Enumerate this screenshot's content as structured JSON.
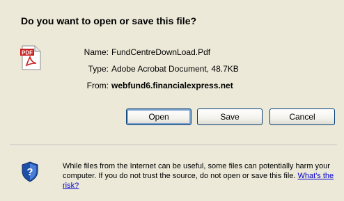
{
  "dialog": {
    "title": "Do you want to open or save this file?"
  },
  "file": {
    "icon": "pdf-file-icon",
    "name_label": "Name:",
    "name_value": "FundCentreDownLoad.Pdf",
    "type_label": "Type:",
    "type_value": "Adobe Acrobat Document, 48.7KB",
    "from_label": "From:",
    "from_value": "webfund6.financialexpress.net"
  },
  "buttons": {
    "open": "Open",
    "save": "Save",
    "cancel": "Cancel"
  },
  "warning": {
    "icon": "shield-icon",
    "text": "While files from the Internet can be useful, some files can potentially harm your computer. If you do not trust the source, do not open or save this file.",
    "link": "What's the risk?"
  },
  "colors": {
    "background": "#ece9d8",
    "link": "#0000cc",
    "button_border": "#003c74",
    "shield_blue": "#1f4ea8",
    "pdf_red": "#cc1f1f"
  }
}
